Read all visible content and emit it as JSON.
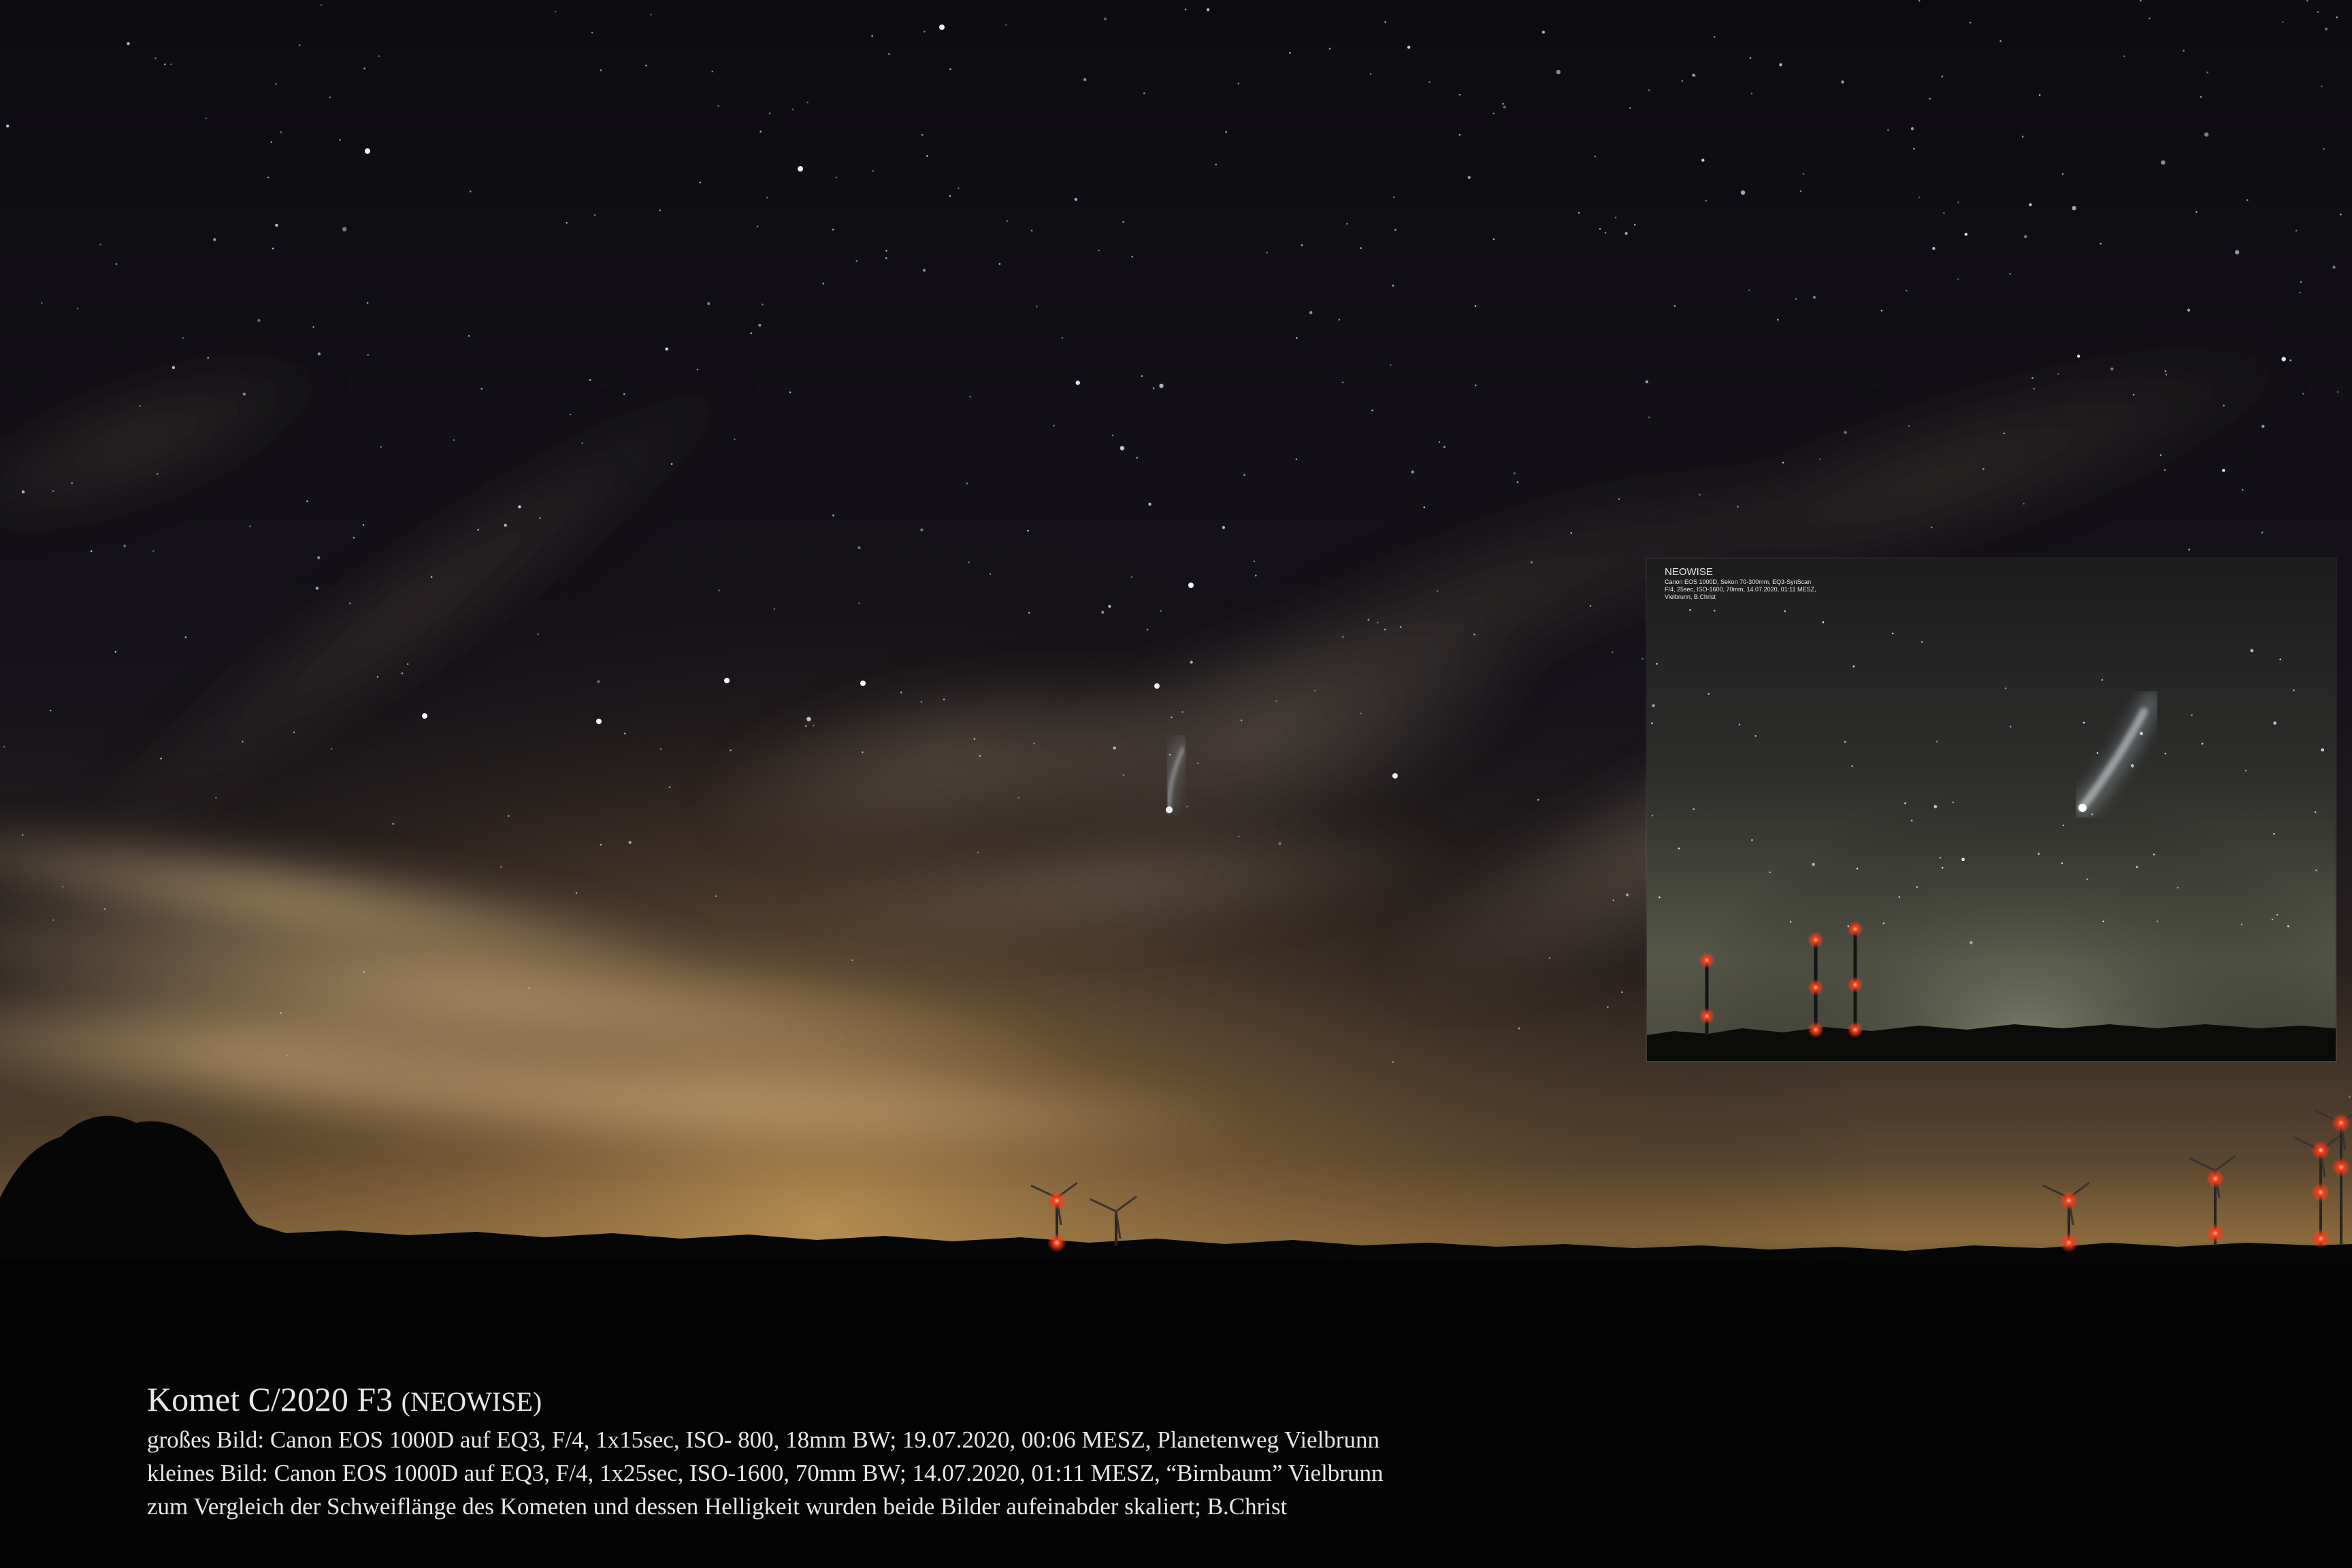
{
  "caption": {
    "title_main": "Komet C/2020 F3",
    "title_small": "(NEOWISE)",
    "lines": [
      "großes  Bild: Canon EOS 1000D auf EQ3, F/4, 1x15sec, ISO- 800, 18mm BW; 19.07.2020, 00:06 MESZ, Planetenweg Vielbrunn",
      "kleines Bild: Canon EOS 1000D auf EQ3, F/4, 1x25sec, ISO-1600, 70mm BW; 14.07.2020, 01:11 MESZ, “Birnbaum” Vielbrunn",
      "zum Vergleich der Schweiflänge des Kometen und dessen Helligkeit wurden beide Bilder aufeinabder skaliert; B.Christ"
    ]
  },
  "inset": {
    "heading": "NEOWISE",
    "lines": [
      "Canon EOS 1000D, Sekon 70-300mm, EQ3-SynScan",
      "F/4, 25sec, ISO-1600, 70mm, 14.07.2020, 01:11 MESZ,",
      "Vielbrunn, B.Christ"
    ]
  },
  "colors": {
    "sky_top": "#0c0b10",
    "sky_horizon_glow": "#b88a4a",
    "cloud_glow": "#c9a97a",
    "inset_sky": "#4a4a3e",
    "warning_light": "#ff3a1a",
    "caption_text": "#e8e6ea"
  }
}
